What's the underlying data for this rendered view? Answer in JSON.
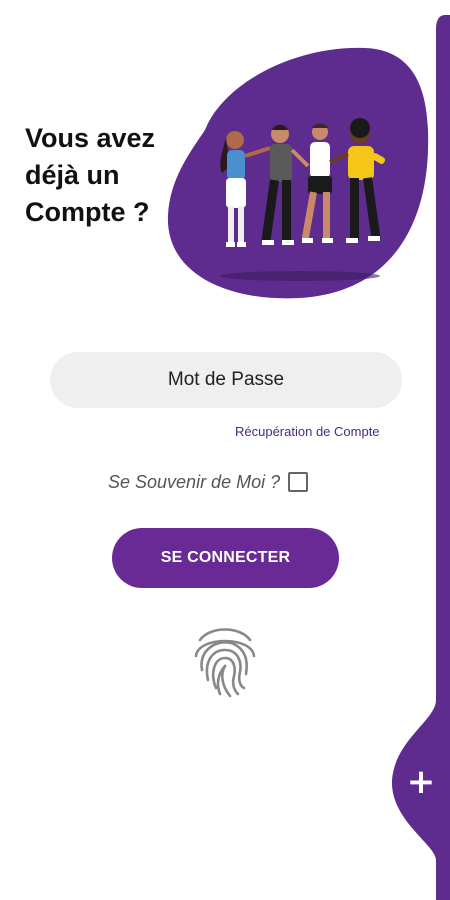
{
  "header": {
    "title_lines": [
      "Vous avez",
      "déjà un",
      "Compte ?"
    ]
  },
  "illustration": {
    "icon": "group-of-friends-illustration"
  },
  "form": {
    "password_placeholder": "Mot de Passe",
    "recovery_link": "Récupération de Compte",
    "remember_label": "Se Souvenir de Moi ?",
    "remember_checked": false,
    "login_label": "SE CONNECTER"
  },
  "biometric": {
    "icon": "fingerprint-icon"
  },
  "fab": {
    "label": "+"
  },
  "colors": {
    "accent": "#5e2b8e",
    "button": "#6a2a96",
    "field_bg": "#efefef"
  }
}
